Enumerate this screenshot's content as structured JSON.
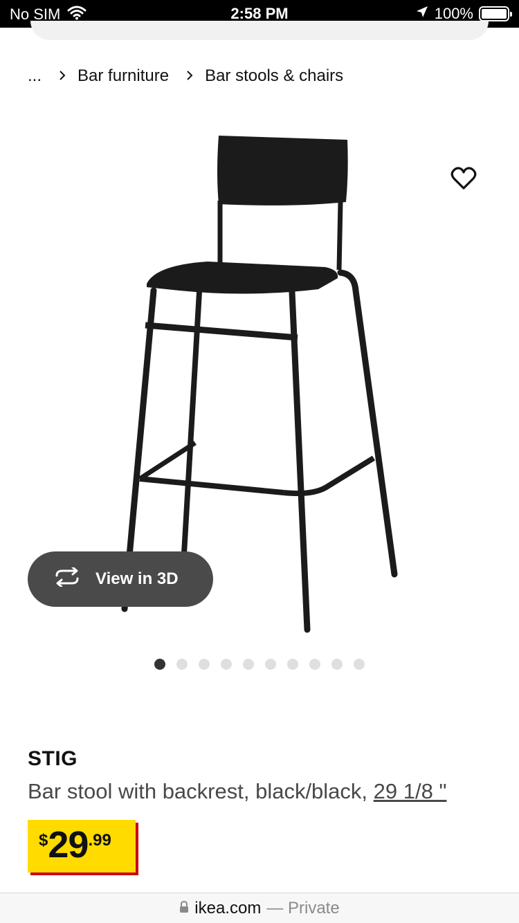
{
  "status_bar": {
    "carrier": "No SIM",
    "time": "2:58 PM",
    "battery": "100%"
  },
  "breadcrumb": {
    "items": [
      {
        "label": "..."
      },
      {
        "label": "Bar furniture"
      },
      {
        "label": "Bar stools & chairs"
      }
    ]
  },
  "product": {
    "name": "STIG",
    "description": "Bar stool with backrest, black/black, ",
    "size_link": "29 1/8 \"",
    "price": {
      "currency": "$",
      "integer": "29",
      "decimal": ".99"
    },
    "colors": {
      "price_bg": "#ffdb00",
      "price_shadow": "#cc0008",
      "view3d_bg": "#4a4a4a"
    }
  },
  "gallery": {
    "view3d_label": "View in 3D",
    "image_count": 10,
    "active_index": 0
  },
  "url_bar": {
    "domain": "ikea.com",
    "mode": "— Private"
  },
  "icons": {
    "wifi": "wifi-icon",
    "location": "location-arrow-icon",
    "battery": "battery-icon",
    "favorite": "heart-icon",
    "rotate": "rotate-3d-icon",
    "lock": "lock-icon",
    "chevron": "chevron-right-icon"
  }
}
